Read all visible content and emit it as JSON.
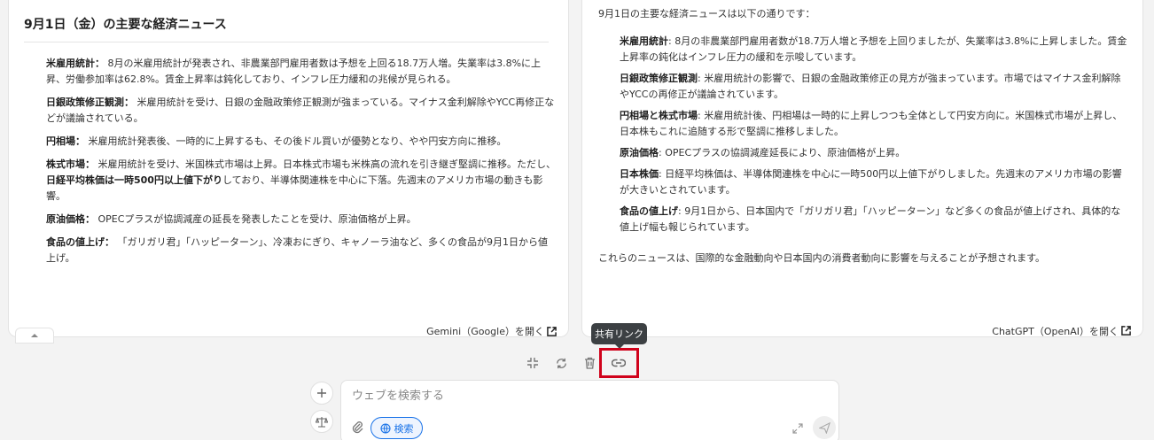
{
  "left_panel": {
    "title": "9月1日（金）の主要な経済ニュース",
    "items": [
      {
        "label": "米雇用統計：",
        "text": " 8月の米雇用統計が発表され、非農業部門雇用者数は予想を上回る18.7万人増。失業率は3.8%に上昇、労働参加率は62.8%。賃金上昇率は鈍化しており、インフレ圧力緩和の兆候が見られる。"
      },
      {
        "label": "日銀政策修正観測：",
        "text": " 米雇用統計を受け、日銀の金融政策修正観測が強まっている。マイナス金利解除やYCC再修正などが議論されている。"
      },
      {
        "label": "円相場：",
        "text": " 米雇用統計発表後、一時的に上昇するも、その後ドル買いが優勢となり、やや円安方向に推移。"
      },
      {
        "label": "株式市場：",
        "text_before": " 米雇用統計を受け、米国株式市場は上昇。日本株式市場も米株高の流れを引き継ぎ堅調に推移。ただし、",
        "bold_mid": "日経平均株価は一時500円以上値下がり",
        "text_after": "しており、半導体関連株を中心に下落。先週末のアメリカ市場の動きも影響。"
      },
      {
        "label": "原油価格：",
        "text": " OPECプラスが協調減産の延長を発表したことを受け、原油価格が上昇。"
      },
      {
        "label": "食品の値上げ：",
        "text": " 「ガリガリ君」「ハッピーターン」、冷凍おにぎり、キャノーラ油など、多くの食品が9月1日から値上げ。"
      }
    ],
    "open_link": "Gemini（Google）を開く"
  },
  "right_panel": {
    "intro": "9月1日の主要な経済ニュースは以下の通りです：",
    "items": [
      {
        "label": "米雇用統計",
        "text": ": 8月の非農業部門雇用者数が18.7万人増と予想を上回りましたが、失業率は3.8%に上昇しました。賃金上昇率の鈍化はインフレ圧力の緩和を示唆しています。"
      },
      {
        "label": "日銀政策修正観測",
        "text": ": 米雇用統計の影響で、日銀の金融政策修正の見方が強まっています。市場ではマイナス金利解除やYCCの再修正が議論されています。"
      },
      {
        "label": "円相場と株式市場",
        "text": ": 米雇用統計後、円相場は一時的に上昇しつつも全体として円安方向に。米国株式市場が上昇し、日本株もこれに追随する形で堅調に推移しました。"
      },
      {
        "label": "原油価格",
        "text": ": OPECプラスの協調減産延長により、原油価格が上昇。"
      },
      {
        "label": "日本株価",
        "text": ": 日経平均株価は、半導体関連株を中心に一時500円以上値下がりしました。先週末のアメリカ市場の影響が大きいとされています。"
      },
      {
        "label": "食品の値上げ",
        "text": ": 9月1日から、日本国内で「ガリガリ君」「ハッピーターン」など多くの食品が値上げされ、具体的な値上げ幅も報じられています。"
      }
    ],
    "outro": "これらのニュースは、国際的な金融動向や日本国内の消費者動向に影響を与えることが予想されます。",
    "open_link": "ChatGPT（OpenAI）を開く"
  },
  "toolbar": {
    "tooltip": "共有リンク",
    "icons": [
      "shrink-icon",
      "refresh-icon",
      "trash-icon",
      "link-icon"
    ]
  },
  "input": {
    "placeholder": "ウェブを検索する",
    "search_chip": "検索"
  },
  "colors": {
    "highlight": "#d0021b",
    "accent": "#1a73e8",
    "tooltip_bg": "#3c4043"
  }
}
